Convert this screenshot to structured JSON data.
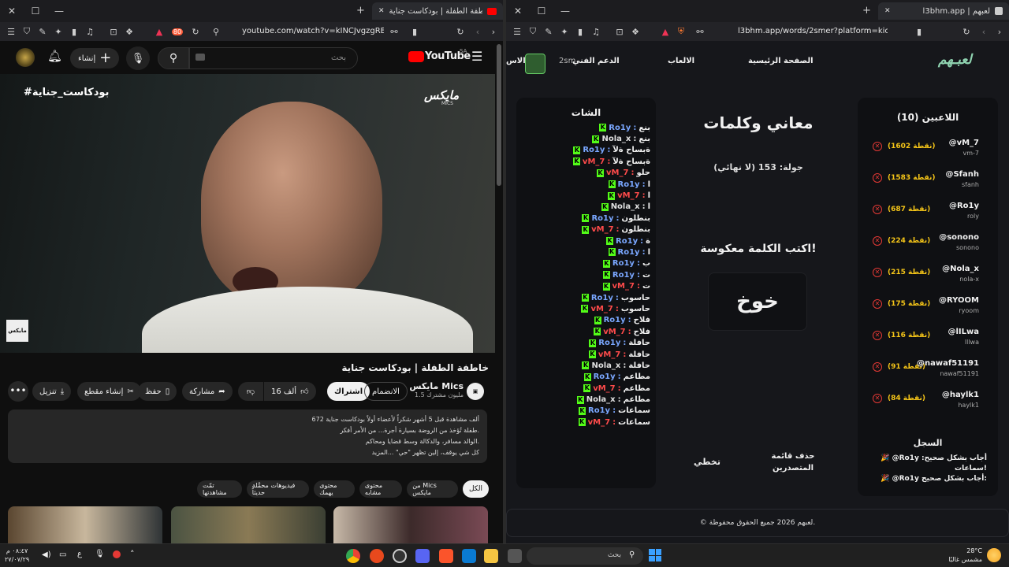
{
  "left_browser": {
    "tab_title": "خاطفة الطفلة | بودكاست جناية",
    "url": "youtube.com/watch?v=kINCJvgzgRE&t=1...",
    "badge_count": "80"
  },
  "youtube": {
    "logo": "YouTube",
    "logo_region": "SA",
    "search_placeholder": "بحث",
    "create_label": "إنشاء",
    "video_hashtag": "#بودكاست_جناية",
    "video_watermark": "مايكس",
    "video_watermark_sub": "MICS",
    "video_title": "خاطفة الطفلة | بودكاست جناية",
    "channel_name": "مايكس Mics",
    "subscribers": "1.5 مليون مشترك",
    "subscribe_label": "اشتراك",
    "join_label": "الانضمام",
    "likes": "16 ألف",
    "share_label": "مشاركة",
    "save_label": "حفظ",
    "clip_label": "إنشاء مقطع",
    "download_label": "تنزيل",
    "description_lines": [
      "672 ألف مشاهدة  قبل 5 أشهر  شكراً لأعضاء أولاً بودكاست جناية",
      "طفلة تُؤخذ من الروضة بسيارة أجرة... من الأمر أفكر.",
      "الوالد مسافر، والدكالة وسط قضايا ومحاكم.",
      "كل شي يوقف، إلين تظهر \"حي\" ...المزيد"
    ],
    "chips": [
      "الكل",
      "من Mics مايكس",
      "محتوى مشابه",
      "محتوى يهمك",
      "فيديوهات محمَّلة حديثاً",
      "تمّت مشاهدتها"
    ]
  },
  "right_browser": {
    "tab_title": "l3bhm.app | لعبهم",
    "url": "l3bhm.app/words/2smer?platform=kick"
  },
  "site": {
    "logo": "لعبـهم",
    "nav": [
      "الصفحة الرئيسية",
      "الالعاب",
      "الدعم الفني",
      "الاس"
    ],
    "nav_user": "2sm",
    "game_title": "معاني وكلمات",
    "round": "جولة: 153 (لا نهائي)",
    "instruction": "اكتب الكلمة معكوسة!",
    "word": "خوخ",
    "skip_label": "تخطي",
    "clear_label": "حذف قائمة المتصدرين",
    "footer": "© لعبهم 2026 جميع الحقوق محفوظة."
  },
  "chat": {
    "title": "الشات",
    "messages": [
      {
        "user": "Ro1y",
        "text": "بنع",
        "color": "#7aa7ff"
      },
      {
        "user": "Nola_x",
        "text": "بنع",
        "color": "#e0e0e0"
      },
      {
        "user": "Ro1y",
        "text": "ةبساح ةلآ",
        "color": "#7aa7ff"
      },
      {
        "user": "vM_7",
        "text": "ةبساح ةلآ",
        "color": "#ff4b4b"
      },
      {
        "user": "vM_7",
        "text": "حلو",
        "color": "#ff4b4b"
      },
      {
        "user": "Ro1y",
        "text": "ا",
        "color": "#7aa7ff"
      },
      {
        "user": "vM_7",
        "text": "ا",
        "color": "#ff4b4b"
      },
      {
        "user": "Nola_x",
        "text": "ا",
        "color": "#e0e0e0"
      },
      {
        "user": "Ro1y",
        "text": "بنطلون",
        "color": "#7aa7ff"
      },
      {
        "user": "vM_7",
        "text": "بنطلون",
        "color": "#ff4b4b"
      },
      {
        "user": "Ro1y",
        "text": "ة",
        "color": "#7aa7ff"
      },
      {
        "user": "Ro1y",
        "text": "ا",
        "color": "#7aa7ff"
      },
      {
        "user": "Ro1y",
        "text": "ب",
        "color": "#7aa7ff"
      },
      {
        "user": "Ro1y",
        "text": "ت",
        "color": "#7aa7ff"
      },
      {
        "user": "vM_7",
        "text": "ت",
        "color": "#ff4b4b"
      },
      {
        "user": "Ro1y",
        "text": "حاسوب",
        "color": "#7aa7ff"
      },
      {
        "user": "vM_7",
        "text": "حاسوب",
        "color": "#ff4b4b"
      },
      {
        "user": "Ro1y",
        "text": "فلاح",
        "color": "#7aa7ff"
      },
      {
        "user": "vM_7",
        "text": "فلاح",
        "color": "#ff4b4b"
      },
      {
        "user": "Ro1y",
        "text": "حافلة",
        "color": "#7aa7ff"
      },
      {
        "user": "vM_7",
        "text": "حافلة",
        "color": "#ff4b4b"
      },
      {
        "user": "Nola_x",
        "text": "حافلة",
        "color": "#e0e0e0"
      },
      {
        "user": "Ro1y",
        "text": "مطاعم",
        "color": "#7aa7ff"
      },
      {
        "user": "vM_7",
        "text": "مطاعم",
        "color": "#ff4b4b"
      },
      {
        "user": "Nola_x",
        "text": "مطاعم",
        "color": "#e0e0e0"
      },
      {
        "user": "Ro1y",
        "text": "سماعات",
        "color": "#7aa7ff"
      },
      {
        "user": "vM_7",
        "text": "سماعات",
        "color": "#ff4b4b"
      }
    ]
  },
  "players": {
    "title": "اللاعبين (10)",
    "list": [
      {
        "handle": "@vM_7",
        "sub": "vm-7",
        "points": "(1602 نقطة)"
      },
      {
        "handle": "@Sfanh",
        "sub": "sfanh",
        "points": "(1583 نقطة)"
      },
      {
        "handle": "@Ro1y",
        "sub": "roly",
        "points": "(687 نقطة)"
      },
      {
        "handle": "@sonono",
        "sub": "sonono",
        "points": "(224 نقطة)"
      },
      {
        "handle": "@Nola_x",
        "sub": "nola-x",
        "points": "(215 نقطة)"
      },
      {
        "handle": "@RYOOM",
        "sub": "ryoom",
        "points": "(175 نقطة)"
      },
      {
        "handle": "@lILwa",
        "sub": "lllwa",
        "points": "(116 نقطة)"
      },
      {
        "handle": "@nawaf51191",
        "sub": "nawaf51191",
        "points": "(91 نقطة)"
      },
      {
        "handle": "@haylk1",
        "sub": "haylk1",
        "points": "(84 نقطة)"
      }
    ]
  },
  "log": {
    "title": "السجل",
    "entries": [
      "🎉 @Ro1y أجاب بشكل صحيح: سماعات!",
      "🎉 @Ro1y أجاب بشكل صحيح:"
    ]
  },
  "taskbar": {
    "search_placeholder": "بحث",
    "time": "٠٨:٤٧ م",
    "date": "٢٧/٠٧/٢٩",
    "weather_temp": "28°C",
    "weather_desc": "مشمس غالبًا",
    "lang": "ع"
  }
}
